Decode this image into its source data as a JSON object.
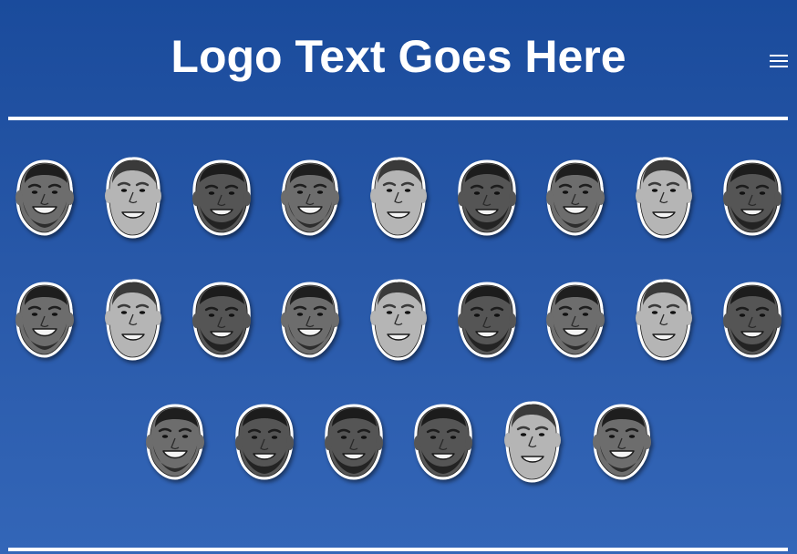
{
  "header": {
    "logo_text": "Logo Text Goes Here",
    "menu_icon": "hamburger-menu-icon"
  },
  "face_grid": {
    "rows": [
      [
        "face-drake",
        "face-jeff",
        "face-lebron",
        "face-drake",
        "face-jeff",
        "face-lebron",
        "face-drake",
        "face-jeff",
        "face-lebron"
      ],
      [
        "face-drake",
        "face-jeff",
        "face-lebron",
        "face-drake",
        "face-jeff",
        "face-lebron",
        "face-drake",
        "face-jeff",
        "face-lebron"
      ],
      [
        "face-drake",
        "face-lebron",
        "face-lebron",
        "face-lebron",
        "face-jeff",
        "face-drake"
      ]
    ]
  },
  "colors": {
    "background_top": "#1a4b9c",
    "background_bottom": "#3366b8",
    "foreground": "#ffffff"
  }
}
